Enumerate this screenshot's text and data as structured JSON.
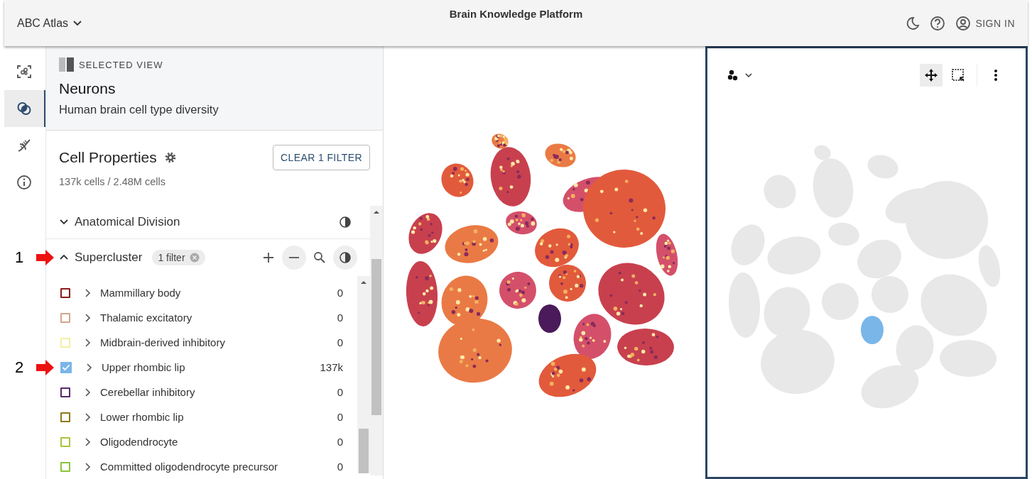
{
  "app_bar": {
    "atlas_menu": "ABC Atlas",
    "title": "Brain Knowledge Platform",
    "sign_in": "SIGN IN"
  },
  "rail": [
    {
      "kind": "scan",
      "selected": false
    },
    {
      "kind": "overlap",
      "selected": true
    },
    {
      "kind": "dna",
      "selected": false
    },
    {
      "kind": "info",
      "selected": false
    }
  ],
  "selected_view": {
    "label": "SELECTED VIEW",
    "name": "Neurons",
    "description": "Human brain cell type diversity"
  },
  "cell_properties": {
    "title": "Cell Properties",
    "count": "137k cells / 2.48M cells",
    "clear_button": "CLEAR 1 FILTER"
  },
  "sections": [
    {
      "name": "Anatomical Division",
      "expanded": false
    },
    {
      "name": "Supercluster",
      "expanded": true,
      "filter_chip": "1 filter",
      "annotation": "1",
      "items": [
        {
          "label": "Mammillary body",
          "count": "0",
          "color": "#8b1c1c",
          "checked": false
        },
        {
          "label": "Thalamic excitatory",
          "count": "0",
          "color": "#d6a58c",
          "checked": false
        },
        {
          "label": "Midbrain-derived inhibitory",
          "count": "0",
          "color": "#f4f0a0",
          "checked": false
        },
        {
          "label": "Upper rhombic lip",
          "count": "137k",
          "color": "#7ab6e8",
          "checked": true,
          "annotation": "2"
        },
        {
          "label": "Cerebellar inhibitory",
          "count": "0",
          "color": "#5a2a6c",
          "checked": false
        },
        {
          "label": "Lower rhombic lip",
          "count": "0",
          "color": "#8c7a1c",
          "checked": false
        },
        {
          "label": "Oligodendrocyte",
          "count": "0",
          "color": "#a8c43c",
          "checked": false
        },
        {
          "label": "Committed oligodendrocyte precursor",
          "count": "0",
          "color": "#8cc43c",
          "checked": false
        }
      ]
    }
  ],
  "view_toolbar": {
    "tools": [
      {
        "kind": "pan",
        "selected": true
      },
      {
        "kind": "select",
        "selected": false
      }
    ]
  }
}
